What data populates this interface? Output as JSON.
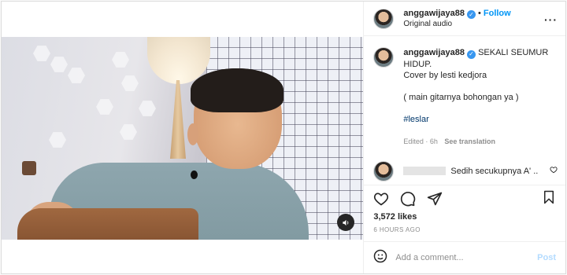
{
  "post": {
    "username": "anggawijaya88",
    "follow_label": "Follow",
    "audio_label": "Original audio",
    "caption": {
      "text_line1": "SEKALI SEUMUR HIDUP.",
      "text_line2": "Cover by lesti kedjora",
      "text_line3": "( main gitarnya bohongan ya )",
      "hashtag": "#leslar",
      "edited_label": "Edited",
      "age": "6h",
      "see_translation": "See translation"
    },
    "comment_preview": "Sedih secukupnya A' ..",
    "likes": "3,572 likes",
    "time_ago": "6 HOURS AGO",
    "add_comment_placeholder": "Add a comment...",
    "post_button": "Post"
  },
  "icons": {
    "verified": "verified-badge-icon",
    "more": "more-options-icon",
    "like": "heart-icon",
    "comment": "comment-icon",
    "share": "send-icon",
    "save": "bookmark-icon",
    "emoji": "emoji-icon",
    "sound": "speaker-icon"
  },
  "colors": {
    "accent": "#0095f6",
    "verified": "#3897f0",
    "muted": "#8e8e8e"
  }
}
